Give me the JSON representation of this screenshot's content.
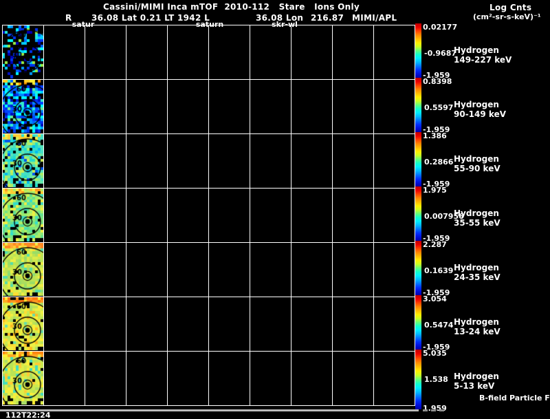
{
  "header": {
    "title": "Cassini/MIMI Inca mTOF  2010-112   Stare   Ions Only",
    "units_line1": "Log Cnts",
    "units_line2": "(cm²-sr-s-keV)⁻¹",
    "status_r": "R",
    "status_mid": "36.08 Lat 0.21 LT 1942 L",
    "status_lon": "36.08 Lon",
    "status_val": "216.87",
    "status_org": "MIMI/APL"
  },
  "column_labels": [
    "satur",
    "saturn",
    "skr-wl"
  ],
  "annotations": {
    "bfield": "B-field Particle Flow",
    "timestamp": "112T22:24"
  },
  "contours": {
    "center": [
      36,
      48
    ],
    "radii": [
      19,
      41
    ],
    "labels": [
      "60",
      "30"
    ]
  },
  "colorbar": {
    "stops": [
      "#bb0000",
      "#ee0000",
      "#ff4400",
      "#ff8800",
      "#ffbb00",
      "#ffee00",
      "#ccff22",
      "#66ff77",
      "#11ffcc",
      "#00eeff",
      "#00bbff",
      "#0077ff",
      "#0033ff",
      "#0011dd",
      "#0000aa"
    ]
  },
  "rows": [
    {
      "species": "Hydrogen",
      "range": "149-227 keV",
      "cbar": {
        "max": "0.02177",
        "mid": "-0.9687",
        "min": "-1.959"
      },
      "heatmap": {
        "seed": 11,
        "black": 0.6,
        "top": null,
        "palette": [
          "#0000bb",
          "#0011cc",
          "#0033ee",
          "#0033ee",
          "#0066ff",
          "#0099ff",
          "#00ccff",
          "#00ffff",
          "#00ffff",
          "#22eedd",
          "#99ee44"
        ]
      }
    },
    {
      "species": "Hydrogen",
      "range": "90-149 keV",
      "cbar": {
        "max": "0.8398",
        "mid": "0.5597",
        "min": "-1.959"
      },
      "heatmap": {
        "seed": 22,
        "black": 0.2,
        "top": [
          "#ffee33",
          "#ffcc22",
          "#ff9900",
          "#00ffff",
          "#0066ff",
          "#ffee33",
          "#33eecc"
        ],
        "palette": [
          "#0022dd",
          "#0044ff",
          "#0066ff",
          "#0088ff",
          "#00aaff",
          "#00ccff",
          "#00ffff",
          "#00ffff",
          "#33eecc",
          "#0033ee",
          "#0011bb",
          "#66ee99"
        ]
      }
    },
    {
      "species": "Hydrogen",
      "range": "55-90 keV",
      "cbar": {
        "max": "1.386",
        "mid": "0.2866",
        "min": "-1.959"
      },
      "heatmap": {
        "seed": 33,
        "black": 0.13,
        "top": [
          "#ffee44",
          "#ddee55",
          "#44e0c4",
          "#33ddcc",
          "#ffcc33"
        ],
        "palette": [
          "#22ddcc",
          "#33ddcc",
          "#44e0c4",
          "#55e5bb",
          "#66e8aa",
          "#44e0c4",
          "#33ddcc",
          "#88ee88",
          "#00bbee",
          "#0055ee",
          "#aaee66",
          "#ccee55"
        ]
      }
    },
    {
      "species": "Hydrogen",
      "range": "35-55 keV",
      "cbar": {
        "max": "1.975",
        "mid": "0.007956",
        "min": "-1.959"
      },
      "heatmap": {
        "seed": 44,
        "black": 0.07,
        "top": [
          "#ffee44",
          "#ffcc33",
          "#cce855",
          "#aaee66",
          "#ff9922"
        ],
        "palette": [
          "#55dd99",
          "#66e08d",
          "#77e583",
          "#88e87a",
          "#99ea70",
          "#aaee66",
          "#ccee55",
          "#44ddbb",
          "#33ddcc",
          "#eeee44",
          "#aaee66",
          "#77e583"
        ]
      }
    },
    {
      "species": "Hydrogen",
      "range": "24-35 keV",
      "cbar": {
        "max": "2.287",
        "mid": "0.1639",
        "min": "-1.959"
      },
      "heatmap": {
        "seed": 55,
        "black": 0.05,
        "top": [
          "#ff8822",
          "#ffaa33",
          "#ffcc33",
          "#eeee44",
          "#ff8822"
        ],
        "palette": [
          "#99dd66",
          "#aadd5f",
          "#bbe355",
          "#cce84f",
          "#dded4a",
          "#eeee44",
          "#eeee44",
          "#88dd77",
          "#55ddaa",
          "#ffdd33",
          "#cce84f",
          "#bbe355"
        ]
      }
    },
    {
      "species": "Hydrogen",
      "range": "13-24 keV",
      "cbar": {
        "max": "3.054",
        "mid": "0.5474",
        "min": "-1.959"
      },
      "heatmap": {
        "seed": 66,
        "black": 0.05,
        "top": [
          "#ff7711",
          "#ff9922",
          "#ffaa22",
          "#ffee33",
          "#ff7711"
        ],
        "palette": [
          "#bbe355",
          "#cce84f",
          "#dded4a",
          "#eeee44",
          "#eeee44",
          "#ffee33",
          "#aadd66",
          "#66ddaa",
          "#ffbb22",
          "#cce84f",
          "#dded4a",
          "#ffdd33"
        ]
      }
    },
    {
      "species": "Hydrogen",
      "range": "5-13 keV",
      "cbar": {
        "max": "5.035",
        "mid": "1.538",
        "min": "1.959"
      },
      "heatmap": {
        "seed": 77,
        "black": 0.06,
        "top": [
          "#ff8811",
          "#ffaa22",
          "#ffee33",
          "#eeee44"
        ],
        "palette": [
          "#bbe355",
          "#cce84f",
          "#dded4a",
          "#eeee44",
          "#ffee33",
          "#aadd66",
          "#44ddbb",
          "#ffcc33",
          "#cce84f",
          "#dded4a"
        ]
      }
    }
  ],
  "chart_data": {
    "type": "heatmap",
    "title": "Cassini/MIMI Inca mTOF 2010-112 Stare Ions Only",
    "units": "Log Cnts (cm²-sr-s-keV)⁻¹",
    "contour_levels_deg": [
      30,
      60
    ],
    "panels": [
      {
        "species": "Hydrogen",
        "energy_range_keV": "149-227",
        "log_counts_max": 0.02177,
        "log_counts_mid": -0.9687,
        "log_counts_min": -1.959
      },
      {
        "species": "Hydrogen",
        "energy_range_keV": "90-149",
        "log_counts_max": 0.8398,
        "log_counts_mid": 0.5597,
        "log_counts_min": -1.959
      },
      {
        "species": "Hydrogen",
        "energy_range_keV": "55-90",
        "log_counts_max": 1.386,
        "log_counts_mid": 0.2866,
        "log_counts_min": -1.959
      },
      {
        "species": "Hydrogen",
        "energy_range_keV": "35-55",
        "log_counts_max": 1.975,
        "log_counts_mid": 0.007956,
        "log_counts_min": -1.959
      },
      {
        "species": "Hydrogen",
        "energy_range_keV": "24-35",
        "log_counts_max": 2.287,
        "log_counts_mid": 0.1639,
        "log_counts_min": -1.959
      },
      {
        "species": "Hydrogen",
        "energy_range_keV": "13-24",
        "log_counts_max": 3.054,
        "log_counts_mid": 0.5474,
        "log_counts_min": -1.959
      },
      {
        "species": "Hydrogen",
        "energy_range_keV": "5-13",
        "log_counts_max": 5.035,
        "log_counts_mid": 1.538,
        "log_counts_min": 1.959
      }
    ],
    "spacecraft_state": {
      "R": 36.08,
      "Lat": 0.21,
      "LT": "1942",
      "L": 36.08,
      "Lon": 216.87
    },
    "timestamp": "112T22:24"
  }
}
